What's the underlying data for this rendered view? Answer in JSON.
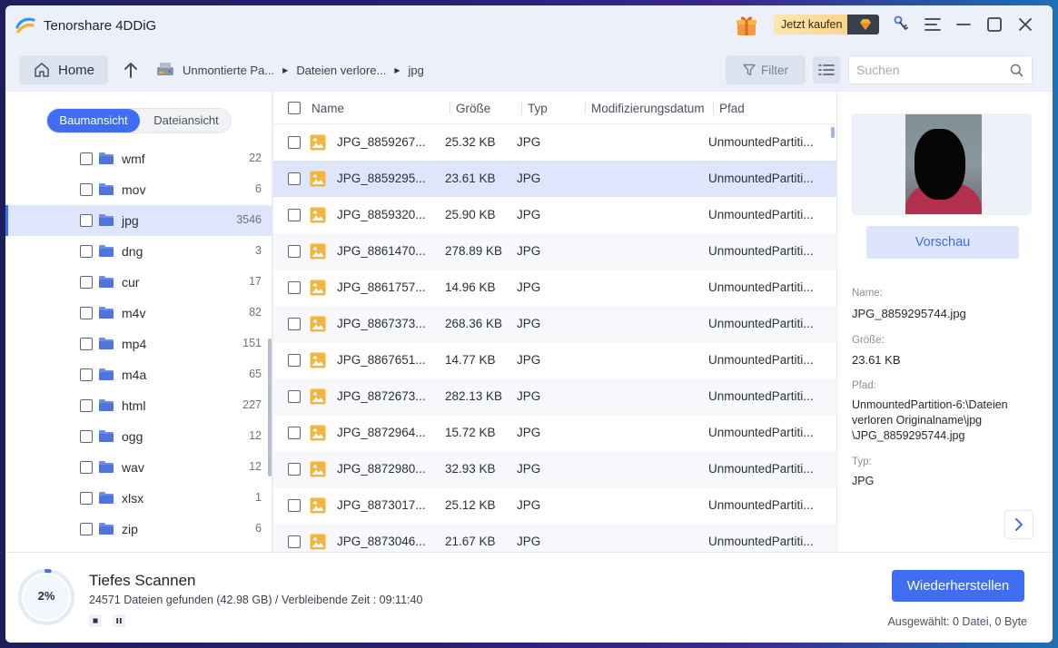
{
  "app": {
    "title": "Tenorshare 4DDiG",
    "buy_label": "Jetzt kaufen"
  },
  "toolbar": {
    "home_label": "Home",
    "breadcrumbs": [
      "Unmontierte Pa...",
      "Dateien verlore...",
      "jpg"
    ],
    "filter_label": "Filter",
    "search_placeholder": "Suchen"
  },
  "view_toggle": {
    "tree": "Baumansicht",
    "file": "Dateiansicht",
    "active": "tree"
  },
  "tree": [
    {
      "name": "wmf",
      "count": "22"
    },
    {
      "name": "mov",
      "count": "6"
    },
    {
      "name": "jpg",
      "count": "3546",
      "selected": true
    },
    {
      "name": "dng",
      "count": "3"
    },
    {
      "name": "cur",
      "count": "17"
    },
    {
      "name": "m4v",
      "count": "82"
    },
    {
      "name": "mp4",
      "count": "151"
    },
    {
      "name": "m4a",
      "count": "65"
    },
    {
      "name": "html",
      "count": "227"
    },
    {
      "name": "ogg",
      "count": "12"
    },
    {
      "name": "wav",
      "count": "12"
    },
    {
      "name": "xlsx",
      "count": "1"
    },
    {
      "name": "zip",
      "count": "6"
    }
  ],
  "table": {
    "headers": {
      "name": "Name",
      "size": "Größe",
      "type": "Typ",
      "modified": "Modifizierungsdatum",
      "path": "Pfad"
    },
    "rows": [
      {
        "name": "JPG_8859267...",
        "size": "25.32 KB",
        "type": "JPG",
        "path": "UnmountedPartiti..."
      },
      {
        "name": "JPG_8859295...",
        "size": "23.61 KB",
        "type": "JPG",
        "path": "UnmountedPartiti...",
        "selected": true
      },
      {
        "name": "JPG_8859320...",
        "size": "25.90 KB",
        "type": "JPG",
        "path": "UnmountedPartiti..."
      },
      {
        "name": "JPG_8861470...",
        "size": "278.89 KB",
        "type": "JPG",
        "path": "UnmountedPartiti..."
      },
      {
        "name": "JPG_8861757...",
        "size": "14.96 KB",
        "type": "JPG",
        "path": "UnmountedPartiti..."
      },
      {
        "name": "JPG_8867373...",
        "size": "268.36 KB",
        "type": "JPG",
        "path": "UnmountedPartiti..."
      },
      {
        "name": "JPG_8867651...",
        "size": "14.77 KB",
        "type": "JPG",
        "path": "UnmountedPartiti..."
      },
      {
        "name": "JPG_8872673...",
        "size": "282.13 KB",
        "type": "JPG",
        "path": "UnmountedPartiti..."
      },
      {
        "name": "JPG_8872964...",
        "size": "15.72 KB",
        "type": "JPG",
        "path": "UnmountedPartiti..."
      },
      {
        "name": "JPG_8872980...",
        "size": "32.93 KB",
        "type": "JPG",
        "path": "UnmountedPartiti..."
      },
      {
        "name": "JPG_8873017...",
        "size": "25.12 KB",
        "type": "JPG",
        "path": "UnmountedPartiti..."
      },
      {
        "name": "JPG_8873046...",
        "size": "21.67 KB",
        "type": "JPG",
        "path": "UnmountedPartiti..."
      }
    ]
  },
  "preview": {
    "button": "Vorschau",
    "name_label": "Name:",
    "name": "JPG_8859295744.jpg",
    "size_label": "Größe:",
    "size": "23.61 KB",
    "path_label": "Pfad:",
    "path_lines": [
      "UnmountedPartition-6:\\Dateien",
      "verloren Originalname\\jpg",
      "\\JPG_8859295744.jpg"
    ],
    "type_label": "Typ:",
    "type": "JPG"
  },
  "scan": {
    "title": "Tiefes Scannen",
    "progress_text": "2%",
    "progress_fraction": 0.02,
    "status": "24571 Dateien gefunden (42.98 GB) /  Verbleibende Zeit : 09:11:40"
  },
  "footer": {
    "restore": "Wiederherstellen",
    "selected": "Ausgewählt: 0 Datei, 0 Byte"
  },
  "colors": {
    "accent": "#3f6ef5",
    "selected_row": "#dfe6fb",
    "folder": "#6d8ee6",
    "image_icon": "#f4b43e"
  }
}
